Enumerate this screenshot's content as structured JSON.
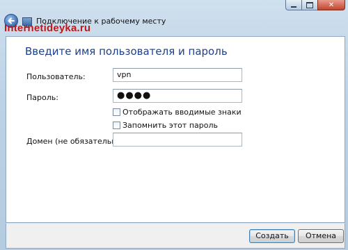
{
  "window": {
    "title": "Подключение к рабочему месту",
    "watermark": "Internetideyka.ru",
    "controls": {
      "minimize_icon": "minimize-icon",
      "maximize_icon": "maximize-icon",
      "close_symbol": "✕"
    }
  },
  "form": {
    "heading": "Введите имя пользователя и пароль",
    "user_label": "Пользователь:",
    "user_value": "vpn",
    "password_label": "Пароль:",
    "password_value": "●●●●",
    "show_chars_label": "Отображать вводимые знаки",
    "remember_label": "Запомнить этот пароль",
    "domain_label": "Домен (не обязательно):",
    "domain_value": ""
  },
  "buttons": {
    "create": "Создать",
    "cancel": "Отмена"
  },
  "colors": {
    "heading": "#1e3f8a",
    "watermark": "#c01818",
    "close_button": "#c3452c"
  }
}
